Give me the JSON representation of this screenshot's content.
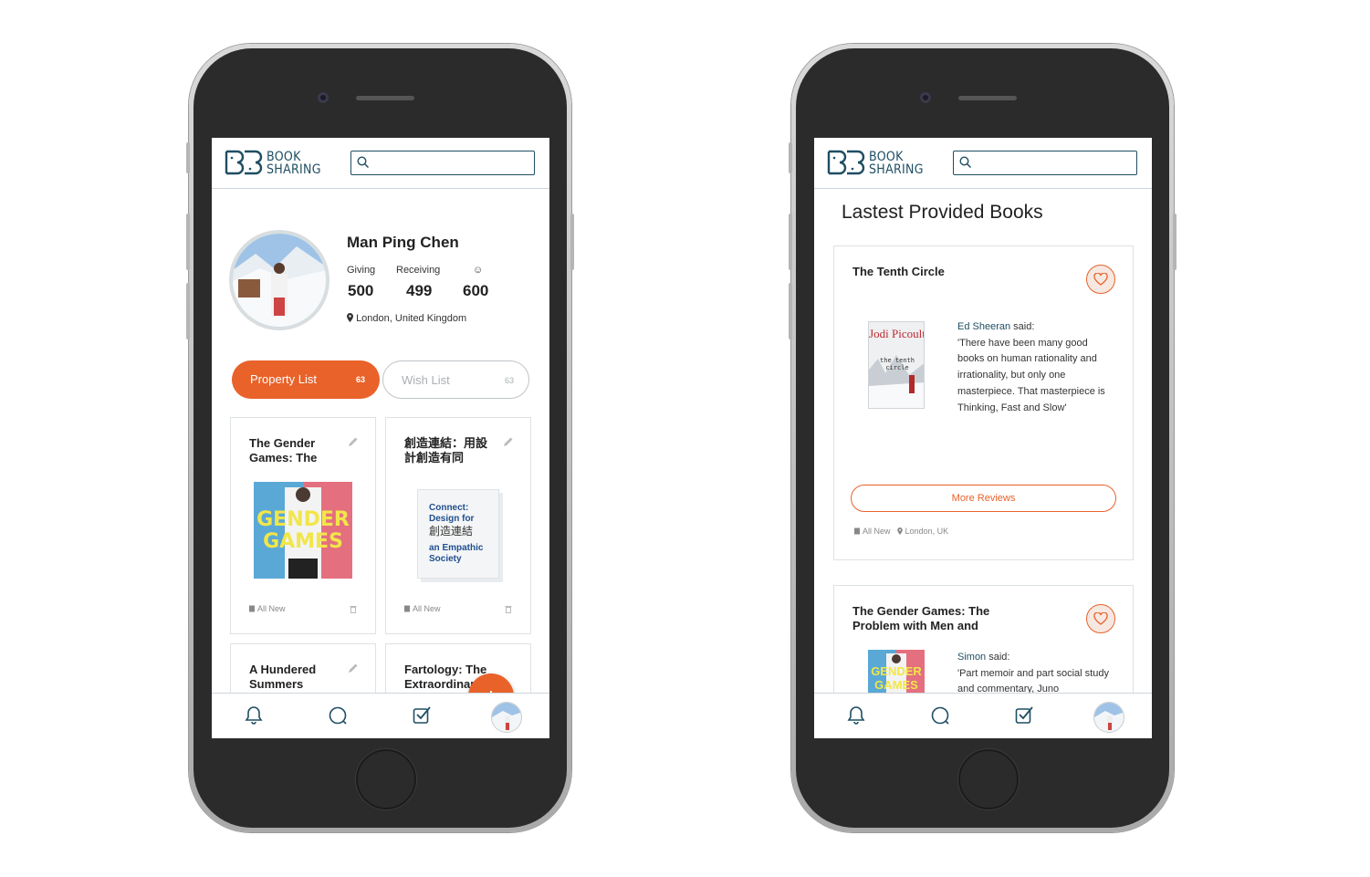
{
  "app": {
    "logo_line1": "BOOK",
    "logo_line2": "SHARING",
    "search_placeholder": ""
  },
  "profile_screen": {
    "name": "Man Ping Chen",
    "stats": [
      {
        "label": "Giving",
        "value": "500"
      },
      {
        "label": "Receiving",
        "value": "499"
      },
      {
        "label": "☺",
        "value": "600"
      }
    ],
    "location": "London, United Kingdom",
    "tabs": [
      {
        "label": "Property List",
        "count": "63",
        "active": true
      },
      {
        "label": "Wish List",
        "count": "63",
        "active": false
      }
    ],
    "cards": [
      {
        "title": "The Gender Games: The",
        "condition": "All New"
      },
      {
        "title": "創造連結：用設計創造有同",
        "condition": "All New"
      },
      {
        "title": "A Hundered Summers",
        "condition": ""
      },
      {
        "title": "Fartology: The Extraordinary",
        "condition": ""
      }
    ],
    "fab_label": "+"
  },
  "feed_screen": {
    "title": "Lastest Provided Books",
    "items": [
      {
        "title": "The Tenth Circle",
        "reviewer": "Ed Sheeran",
        "said": " said:",
        "quote": "'There have been many good books on human rationality and irrationality, but only one masterpiece. That masterpiece is Thinking, Fast and Slow'",
        "more_label": "More Reviews",
        "condition": "All New",
        "location": "London, UK",
        "cover_author": "Jodi Picoult",
        "cover_title": "the tenth circle"
      },
      {
        "title": "The Gender Games: The Problem with Men and",
        "reviewer": "Simon",
        "said": " said:",
        "quote": "'Part memoir and part social study and commentary, Juno"
      }
    ]
  },
  "covers": {
    "gender_games_text": "GENDER GAMES",
    "connect_line1": "Connect:",
    "connect_line2": "Design for",
    "connect_line3": "創造連結",
    "connect_line4": "an Empathic",
    "connect_line5": "Society"
  },
  "bottom_nav": {
    "items": [
      "bell-icon",
      "chat-icon",
      "checkbox-icon",
      "profile-avatar"
    ]
  },
  "colors": {
    "accent": "#e8622a",
    "brand": "#1f4e63",
    "phone_body": "#2b2b2b"
  }
}
